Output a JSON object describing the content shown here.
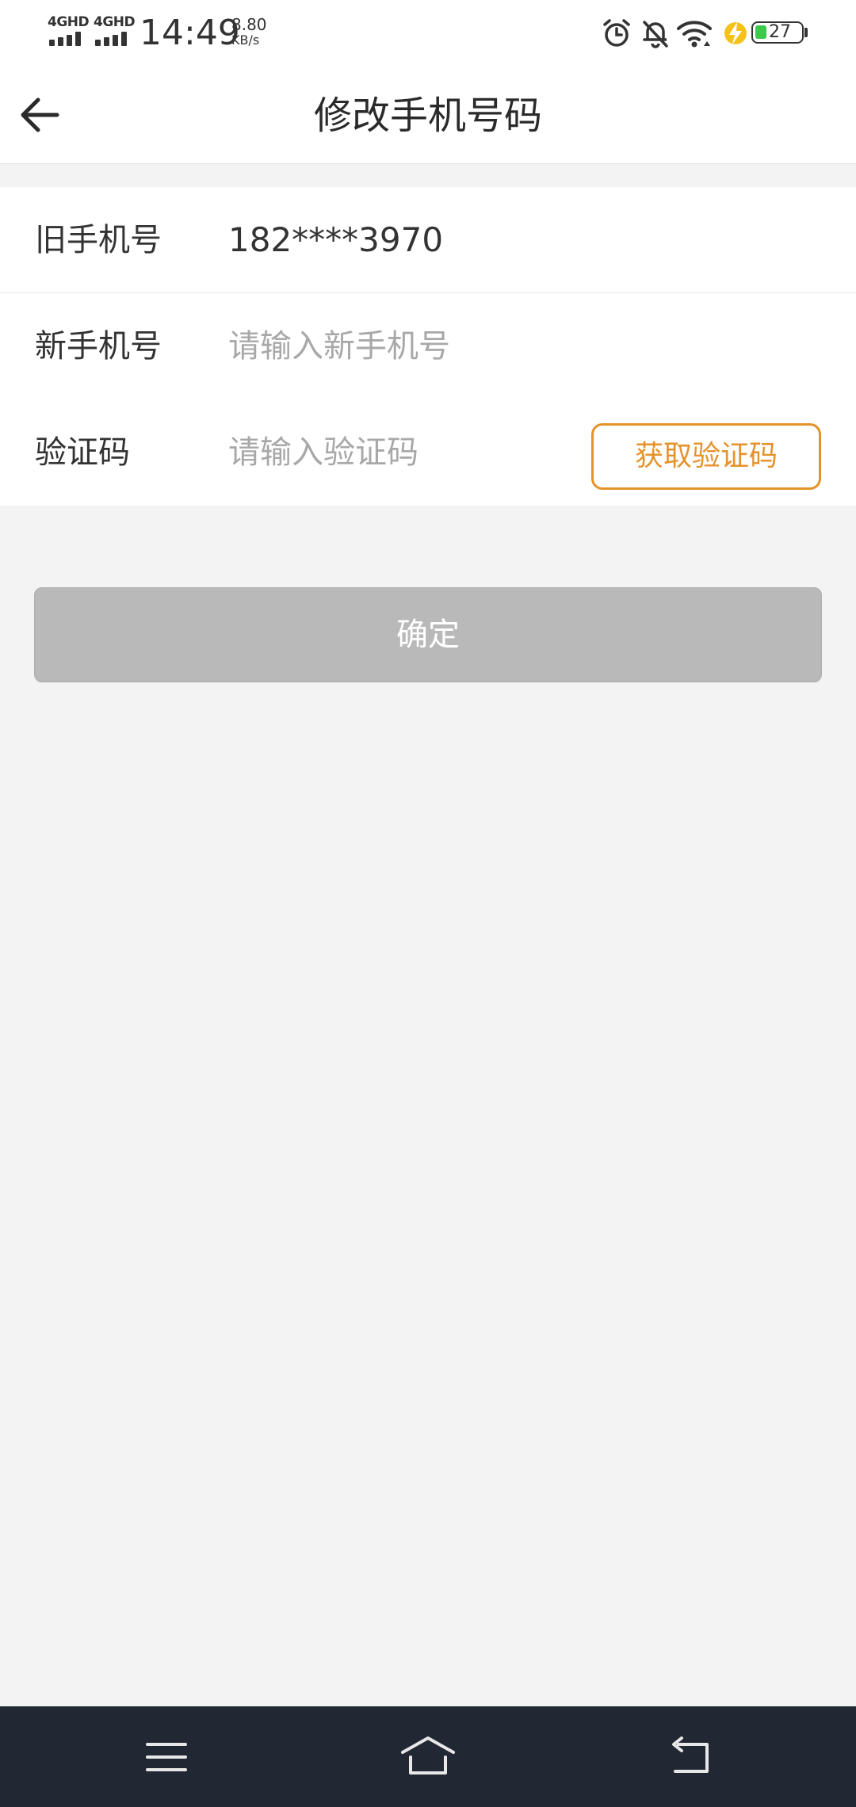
{
  "status_bar": {
    "sim1_label": "4GHD",
    "sim2_label": "4GHD",
    "time": "14:49",
    "net_speed_value": "8.80",
    "net_speed_unit": "KB/s",
    "battery_level": "27",
    "icons": [
      "alarm-icon",
      "silent-bell-icon",
      "wifi-icon",
      "charging-icon",
      "battery-icon"
    ]
  },
  "header": {
    "back_icon": "arrow-left-icon",
    "title": "修改手机号码"
  },
  "form": {
    "old_phone": {
      "label": "旧手机号",
      "value": "182****3970"
    },
    "new_phone": {
      "label": "新手机号",
      "placeholder": "请输入新手机号",
      "value": ""
    },
    "code": {
      "label": "验证码",
      "placeholder": "请输入验证码",
      "value": "",
      "button_label": "获取验证码"
    }
  },
  "confirm_label": "确定",
  "colors": {
    "accent": "#e5922a",
    "button_disabled": "#b9b9b9",
    "background": "#f3f3f3",
    "nav_bar": "#212733",
    "battery_fill": "#3bc94b"
  },
  "nav_bar": {
    "icons": [
      "menu-icon",
      "home-icon",
      "back-icon"
    ]
  }
}
